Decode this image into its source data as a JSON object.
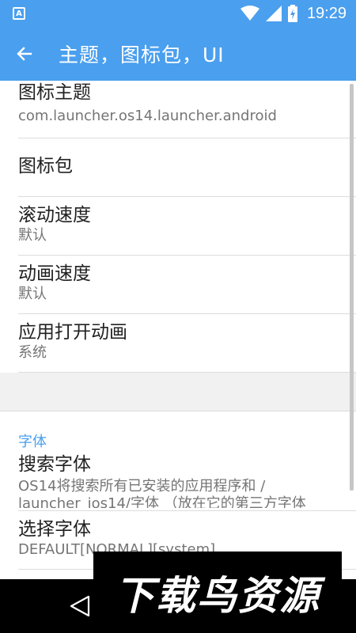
{
  "status_bar": {
    "notification_icon": "A",
    "time": "19:29"
  },
  "app_bar": {
    "title": "主题，图标包，UI"
  },
  "preferences": [
    {
      "title": "图标主题",
      "summary": "com.launcher.os14.launcher.android"
    },
    {
      "title": "图标包",
      "summary": ""
    },
    {
      "title": "滚动速度",
      "summary": "默认"
    },
    {
      "title": "动画速度",
      "summary": "默认"
    },
    {
      "title": "应用打开动画",
      "summary": "系统"
    }
  ],
  "font_section": {
    "category": "字体",
    "items": [
      {
        "title": "搜索字体",
        "summary": "OS14将搜索所有已安装的应用程序和 / launcher_ios14/字体 （放在它的第三方字体"
      },
      {
        "title": "选择字体",
        "summary": "DEFAULT[NORMAL][system]"
      }
    ]
  },
  "watermark": "下载鸟资源",
  "colors": {
    "primary": "#4a9fee",
    "divider": "#dcdcdc",
    "summary": "#757575"
  }
}
